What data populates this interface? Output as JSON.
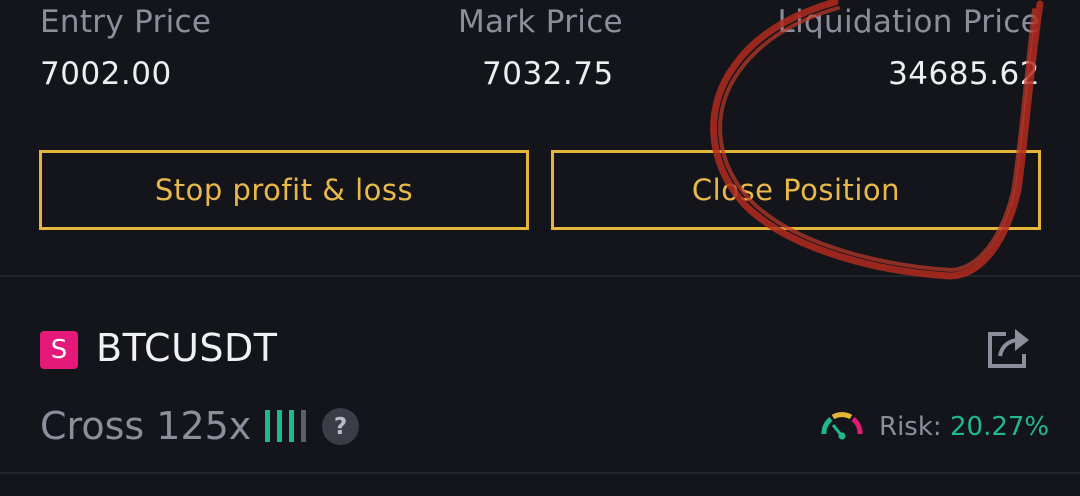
{
  "position": {
    "entry_price_label": "Entry Price",
    "entry_price": "7002.00",
    "mark_price_label": "Mark Price",
    "mark_price": "7032.75",
    "liquidation_price_label": "Liquidation Price",
    "liquidation_price": "34685.62"
  },
  "actions": {
    "stop_profit_loss_label": "Stop profit & loss",
    "close_position_label": "Close Position"
  },
  "contract": {
    "badge": "S",
    "symbol": "BTCUSDT",
    "share_icon": "share-icon",
    "margin_mode": "Cross",
    "leverage": "125x",
    "leverage_level_bars": 4,
    "leverage_level_active": 3,
    "help_icon": "?",
    "risk_label": "Risk:",
    "risk_value": "20.27%",
    "risk_gauge_icon": "gauge-icon"
  },
  "colors": {
    "background": "#14151a",
    "accent_gold": "#e3b53a",
    "positive_green": "#1fb98b",
    "badge_pink": "#e5197a",
    "annotation_red": "#b02a20"
  }
}
